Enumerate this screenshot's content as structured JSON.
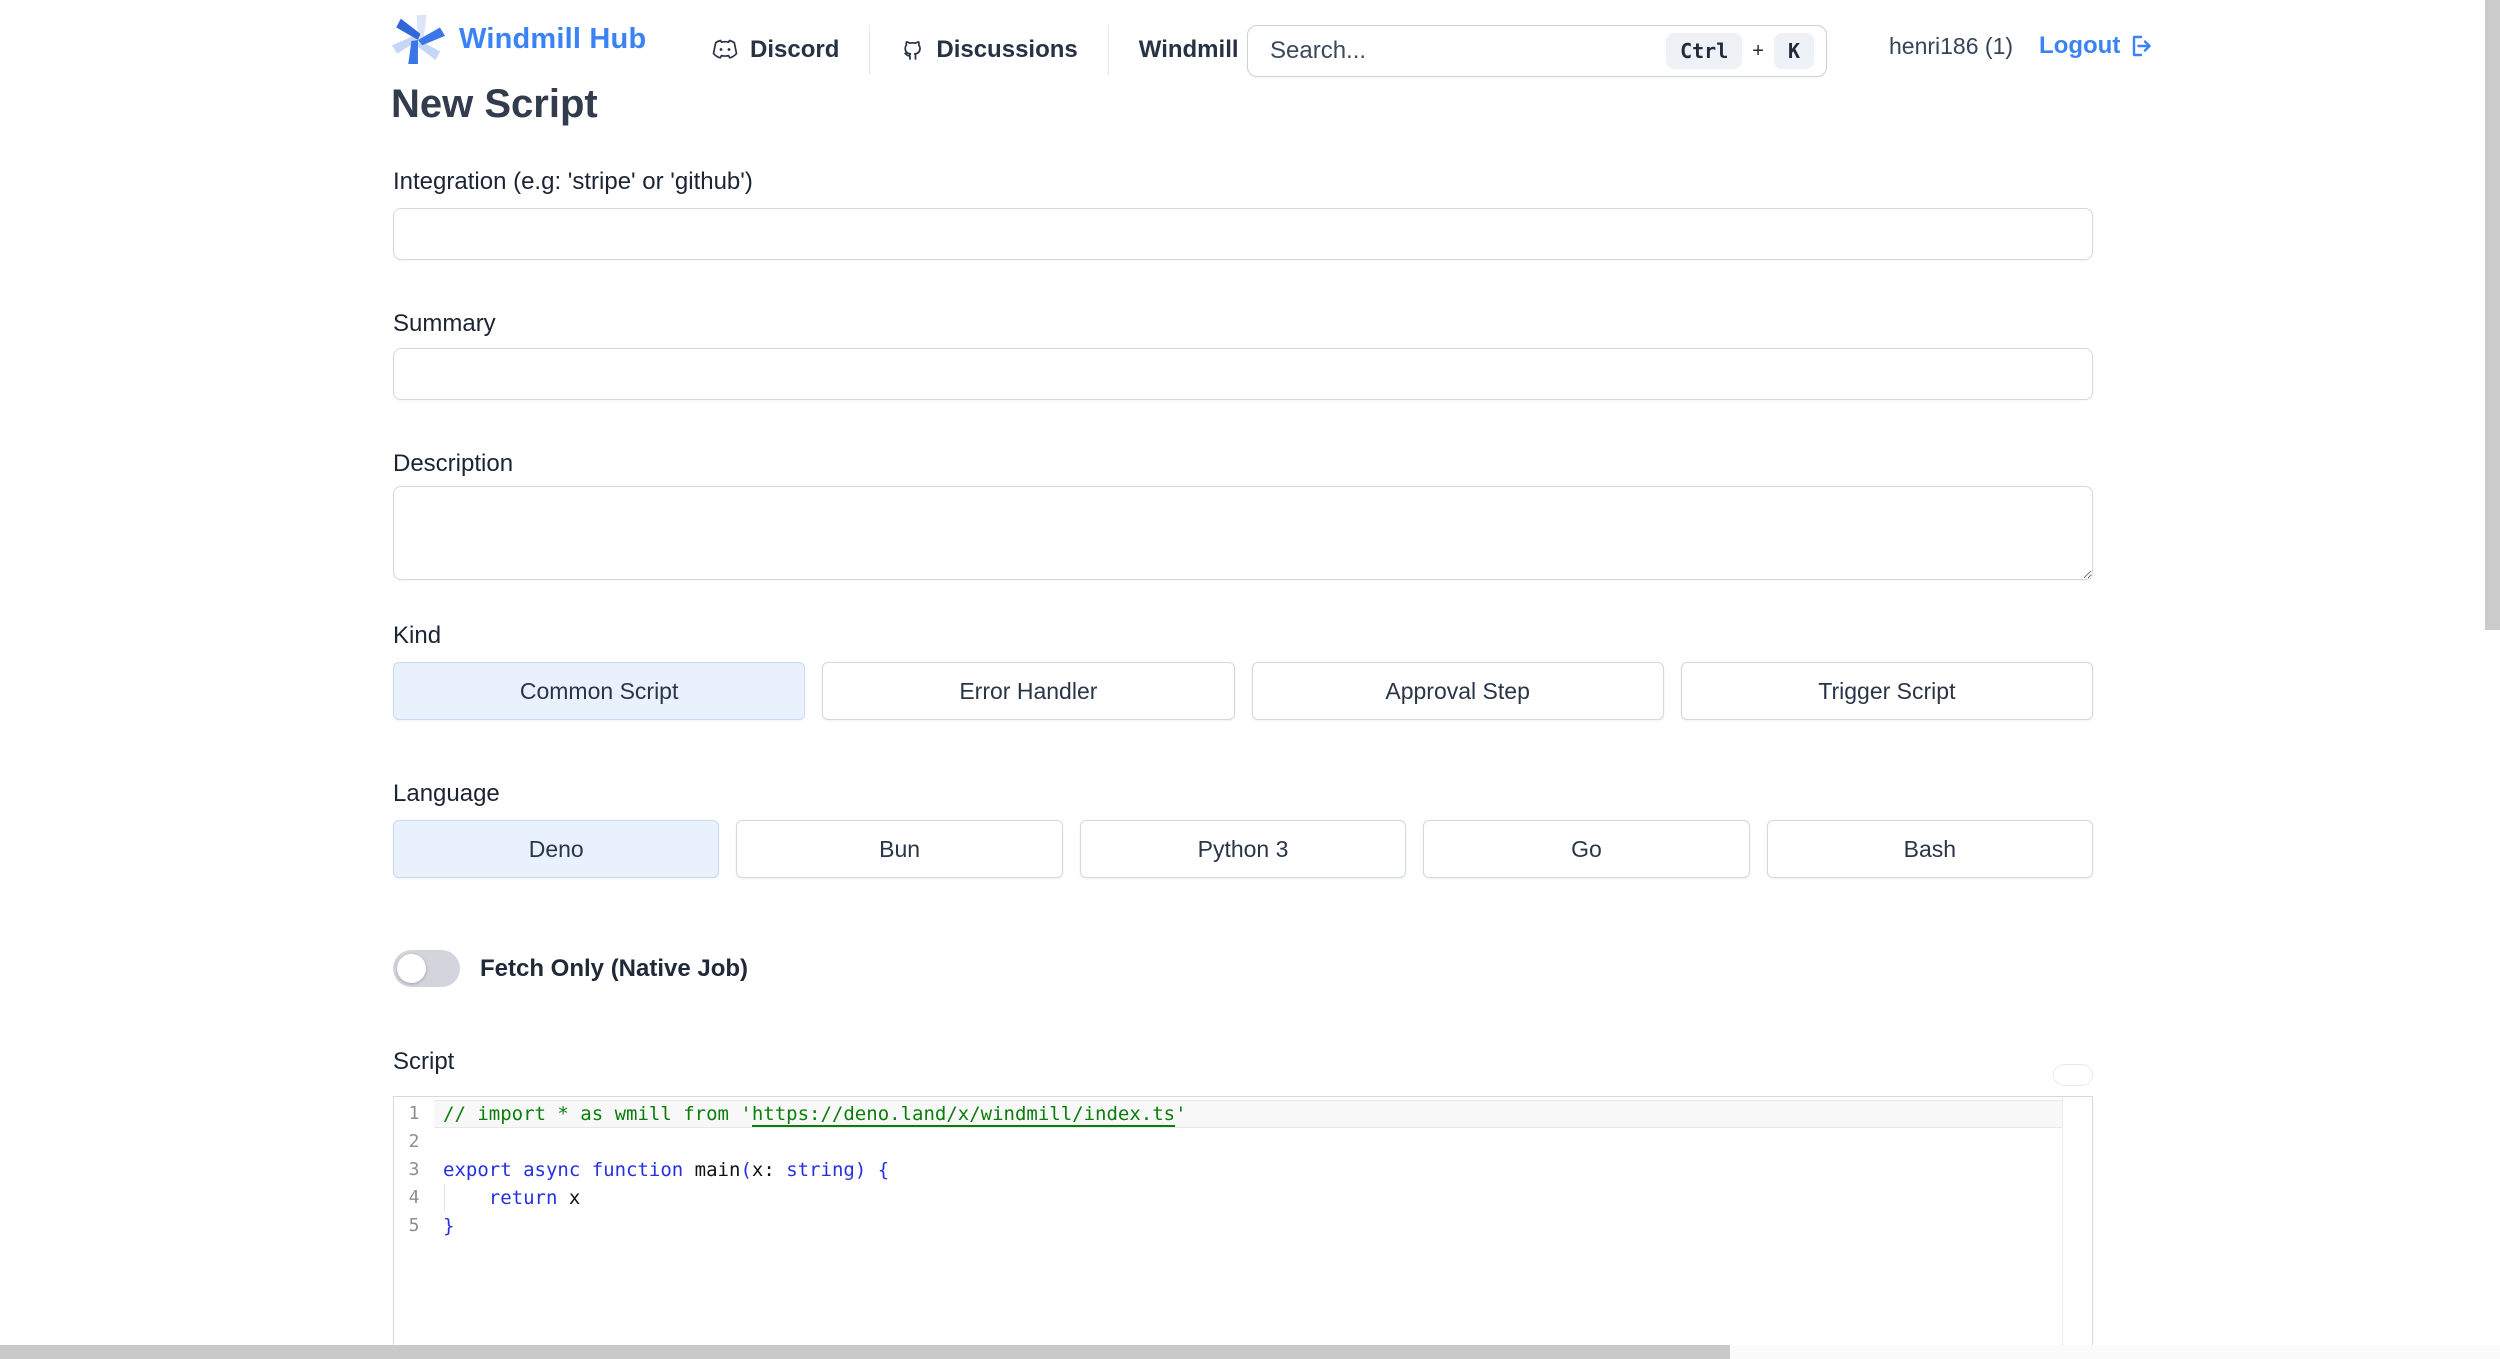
{
  "header": {
    "brand": "Windmill Hub",
    "nav": {
      "discord": "Discord",
      "discussions": "Discussions",
      "windmill": "Windmill"
    },
    "search": {
      "placeholder": "Search...",
      "kbd_ctrl": "Ctrl",
      "kbd_plus": "+",
      "kbd_k": "K"
    },
    "account": {
      "username": "henri186 (1)",
      "logout_label": "Logout"
    }
  },
  "page": {
    "title": "New Script"
  },
  "form": {
    "integration": {
      "label": "Integration (e.g: 'stripe' or 'github')",
      "value": ""
    },
    "summary": {
      "label": "Summary",
      "value": ""
    },
    "description": {
      "label": "Description",
      "value": ""
    },
    "kind": {
      "label": "Kind",
      "options": [
        "Common Script",
        "Error Handler",
        "Approval Step",
        "Trigger Script"
      ],
      "selected": "Common Script"
    },
    "language": {
      "label": "Language",
      "options": [
        "Deno",
        "Bun",
        "Python 3",
        "Go",
        "Bash"
      ],
      "selected": "Deno"
    },
    "fetch_only": {
      "label": "Fetch Only (Native Job)",
      "enabled": false
    },
    "script": {
      "label": "Script"
    }
  },
  "editor": {
    "lines": [
      {
        "no": "1",
        "active": true,
        "segments": [
          {
            "t": "// import * as wmill from '",
            "c": "comment"
          },
          {
            "t": "https://deno.land/x/windmill/index.ts",
            "c": "comment-link"
          },
          {
            "t": "'",
            "c": "comment"
          }
        ]
      },
      {
        "no": "2",
        "segments": []
      },
      {
        "no": "3",
        "segments": [
          {
            "t": "export async function ",
            "c": "keyword"
          },
          {
            "t": "main",
            "c": "plain"
          },
          {
            "t": "(",
            "c": "bracket"
          },
          {
            "t": "x",
            "c": "plain"
          },
          {
            "t": ": ",
            "c": "plain"
          },
          {
            "t": "string",
            "c": "keyword"
          },
          {
            "t": ") {",
            "c": "bracket"
          }
        ]
      },
      {
        "no": "4",
        "guide": true,
        "segments": [
          {
            "t": "    ",
            "c": "plain"
          },
          {
            "t": "return",
            "c": "keyword"
          },
          {
            "t": " x",
            "c": "plain"
          }
        ]
      },
      {
        "no": "5",
        "segments": [
          {
            "t": "}",
            "c": "bracket"
          }
        ]
      }
    ]
  },
  "colors": {
    "brand_blue": "#3b82f6",
    "selected_bg": "#e9f1fd",
    "comment_green": "#0b7d0b",
    "keyword_blue": "#2430e0"
  }
}
